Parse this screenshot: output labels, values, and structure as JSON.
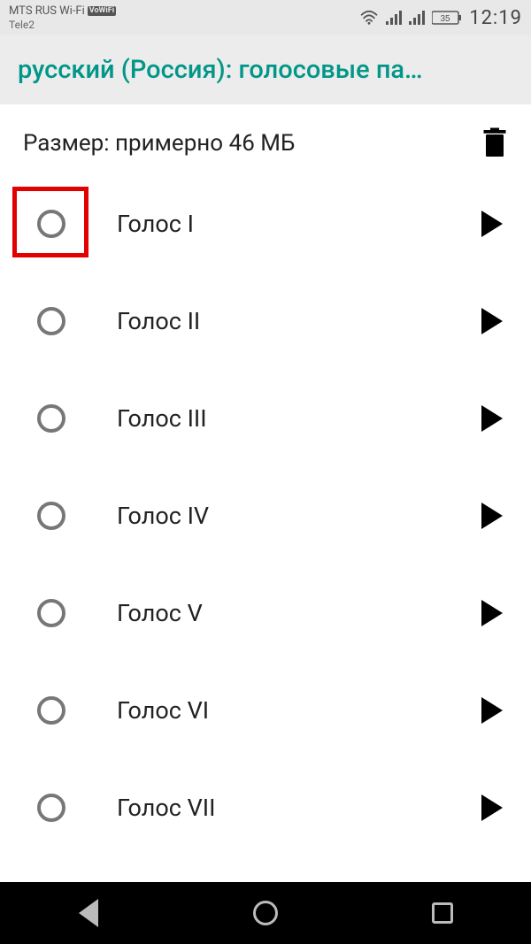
{
  "statusbar": {
    "carrier_line1": "MTS RUS Wi-Fi",
    "vowifi_badge": "VoWiFi",
    "carrier_line2": "Tele2",
    "battery_level": "35",
    "time": "12:19"
  },
  "header": {
    "title": "русский (Россия): голосовые па…"
  },
  "size_row": {
    "text": "Размер: примерно 46 МБ"
  },
  "voices": [
    {
      "label": "Голос I",
      "highlight": true
    },
    {
      "label": "Голос II",
      "highlight": false
    },
    {
      "label": "Голос III",
      "highlight": false
    },
    {
      "label": "Голос IV",
      "highlight": false
    },
    {
      "label": "Голос V",
      "highlight": false
    },
    {
      "label": "Голос VI",
      "highlight": false
    },
    {
      "label": "Голос VII",
      "highlight": false
    }
  ]
}
